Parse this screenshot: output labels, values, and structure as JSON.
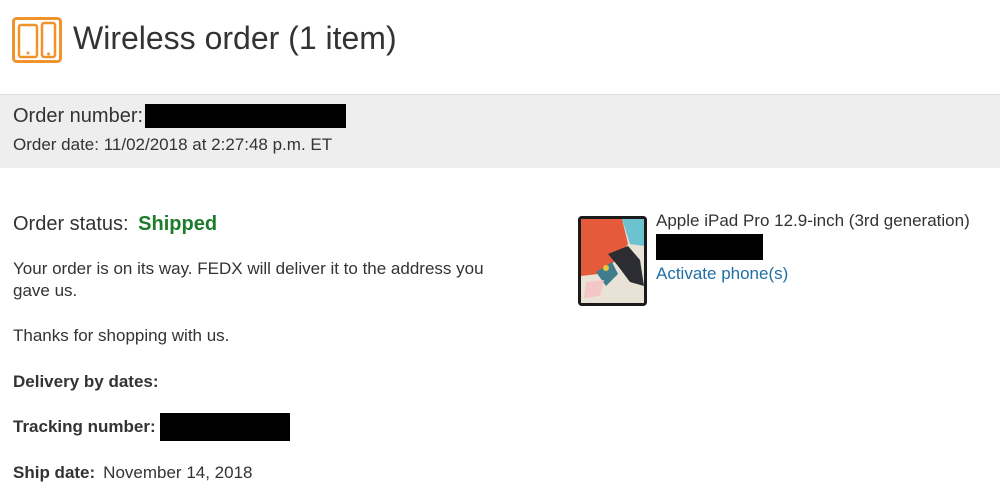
{
  "header": {
    "title": "Wireless order (1 item)",
    "icon": "devices-icon",
    "icon_color": "#f0932b"
  },
  "order": {
    "number_label": "Order number:",
    "date_text": "Order date: 11/02/2018 at 2:27:48 p.m. ET"
  },
  "status": {
    "label": "Order status:",
    "value": "Shipped",
    "value_color": "#1e7b2c",
    "message": "Your order is on its way. FEDX will deliver it to the address you gave us.",
    "thanks": "Thanks for shopping with us."
  },
  "fields": {
    "delivery_label": "Delivery by dates:",
    "tracking_label": "Tracking number:",
    "ship_label": "Ship date:",
    "ship_value": "November 14, 2018"
  },
  "product": {
    "name": "Apple iPad Pro 12.9-inch (3rd generation)",
    "activate_link": "Activate phone(s)",
    "link_color": "#1f6fa5"
  }
}
